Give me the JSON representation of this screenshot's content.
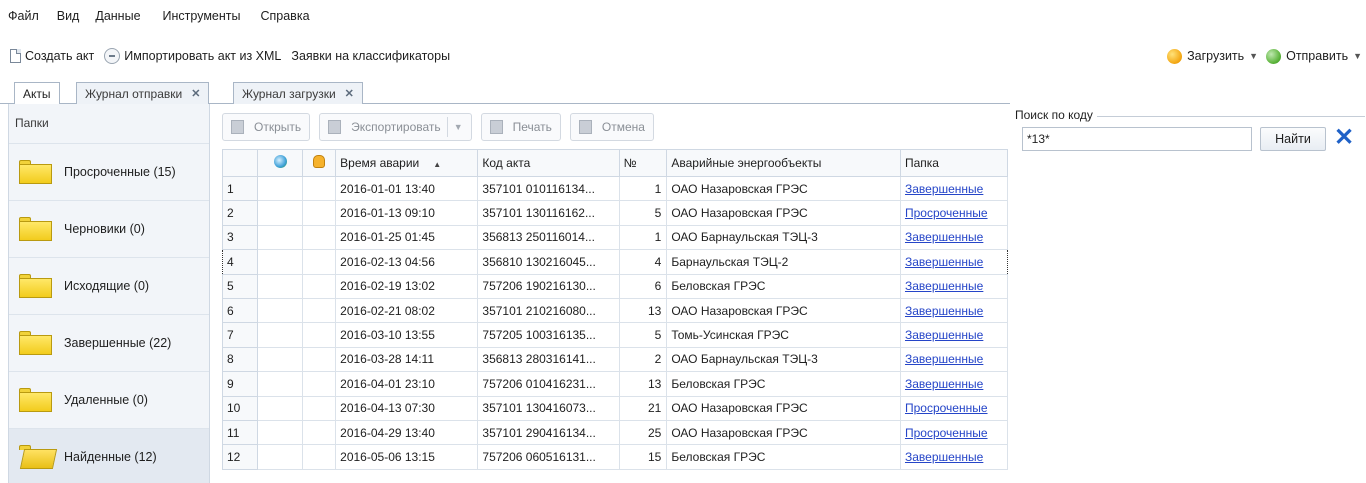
{
  "menu": [
    "Файл",
    "Вид",
    "Данные",
    "Инструменты",
    "Справка"
  ],
  "toolbar": {
    "create_act": "Создать акт",
    "import_xml": "Импортировать акт из XML",
    "classifier_requests": "Заявки на классификаторы",
    "load": "Загрузить",
    "send": "Отправить"
  },
  "tabs": [
    "Акты",
    "Журнал отправки",
    "Журнал загрузки"
  ],
  "left_panel": {
    "header": "Папки",
    "folders": [
      {
        "label": "Просроченные (15)"
      },
      {
        "label": "Черновики (0)"
      },
      {
        "label": "Исходящие (0)"
      },
      {
        "label": "Завершенные (22)"
      },
      {
        "label": "Удаленные (0)"
      },
      {
        "label": "Найденные (12)"
      }
    ]
  },
  "grid_toolbar": {
    "open": "Открыть",
    "export": "Экспортировать",
    "print": "Печать",
    "cancel": "Отмена"
  },
  "columns": {
    "time": "Время аварии",
    "code": "Код акта",
    "no": "№",
    "objects": "Аварийные энергообъекты",
    "folder": "Папка"
  },
  "rows": [
    {
      "n": "1",
      "time": "2016-01-01 13:40",
      "code": "357101 010116134...",
      "no": "1",
      "obj": "ОАО Назаровская ГРЭС",
      "folder": "Завершенные"
    },
    {
      "n": "2",
      "time": "2016-01-13 09:10",
      "code": "357101 130116162...",
      "no": "5",
      "obj": "ОАО Назаровская ГРЭС",
      "folder": "Просроченные"
    },
    {
      "n": "3",
      "time": "2016-01-25 01:45",
      "code": "356813 250116014...",
      "no": "1",
      "obj": "ОАО Барнаульская ТЭЦ-3",
      "folder": "Завершенные"
    },
    {
      "n": "4",
      "time": "2016-02-13 04:56",
      "code": "356810 130216045...",
      "no": "4",
      "obj": "Барнаульская ТЭЦ-2",
      "folder": "Завершенные"
    },
    {
      "n": "5",
      "time": "2016-02-19 13:02",
      "code": "757206 190216130...",
      "no": "6",
      "obj": "Беловская ГРЭС",
      "folder": "Завершенные"
    },
    {
      "n": "6",
      "time": "2016-02-21 08:02",
      "code": "357101 210216080...",
      "no": "13",
      "obj": "ОАО Назаровская ГРЭС",
      "folder": "Завершенные"
    },
    {
      "n": "7",
      "time": "2016-03-10 13:55",
      "code": "757205 100316135...",
      "no": "5",
      "obj": "Томь-Усинская ГРЭС",
      "folder": "Завершенные"
    },
    {
      "n": "8",
      "time": "2016-03-28 14:11",
      "code": "356813 280316141...",
      "no": "2",
      "obj": "ОАО Барнаульская ТЭЦ-3",
      "folder": "Завершенные"
    },
    {
      "n": "9",
      "time": "2016-04-01 23:10",
      "code": "757206 010416231...",
      "no": "13",
      "obj": "Беловская ГРЭС",
      "folder": "Завершенные"
    },
    {
      "n": "10",
      "time": "2016-04-13 07:30",
      "code": "357101 130416073...",
      "no": "21",
      "obj": "ОАО Назаровская ГРЭС",
      "folder": "Просроченные"
    },
    {
      "n": "11",
      "time": "2016-04-29 13:40",
      "code": "357101 290416134...",
      "no": "25",
      "obj": "ОАО Назаровская ГРЭС",
      "folder": "Просроченные"
    },
    {
      "n": "12",
      "time": "2016-05-06 13:15",
      "code": "757206 060516131...",
      "no": "15",
      "obj": "Беловская ГРЭС",
      "folder": "Завершенные"
    }
  ],
  "search": {
    "legend": "Поиск по коду",
    "value": "*13*",
    "button": "Найти"
  }
}
